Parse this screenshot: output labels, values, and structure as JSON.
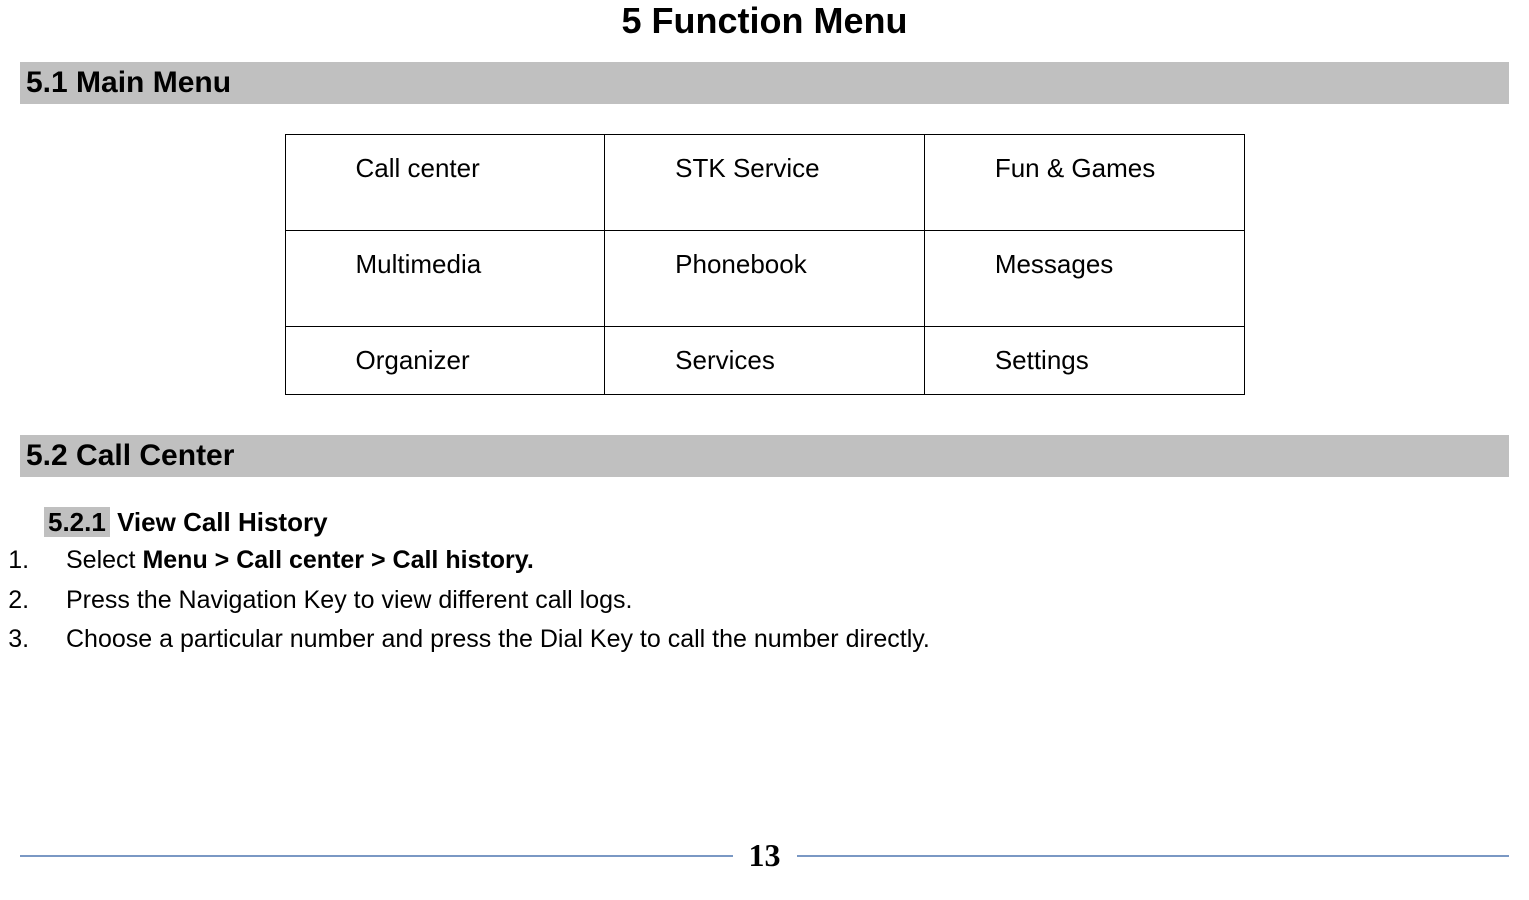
{
  "chapter_title": "5 Function Menu",
  "sections": {
    "main_menu": {
      "heading": "5.1 Main Menu",
      "rows": [
        [
          "Call center",
          "STK Service",
          "Fun & Games"
        ],
        [
          "Multimedia",
          "Phonebook",
          "Messages"
        ],
        [
          "Organizer",
          "Services",
          "Settings"
        ]
      ]
    },
    "call_center": {
      "heading": "5.2 Call Center",
      "subsections": {
        "view_history": {
          "number": "5.2.1",
          "title": "View Call History",
          "steps": [
            {
              "prefix": "Select ",
              "bold": "Menu > Call center > Call history.",
              "suffix": ""
            },
            {
              "prefix": "Press the Navigation Key to view different call logs.",
              "bold": "",
              "suffix": ""
            },
            {
              "prefix": "Choose a particular number and press the Dial Key to call the number directly.",
              "bold": "",
              "suffix": ""
            }
          ]
        }
      }
    }
  },
  "page_number": "13"
}
